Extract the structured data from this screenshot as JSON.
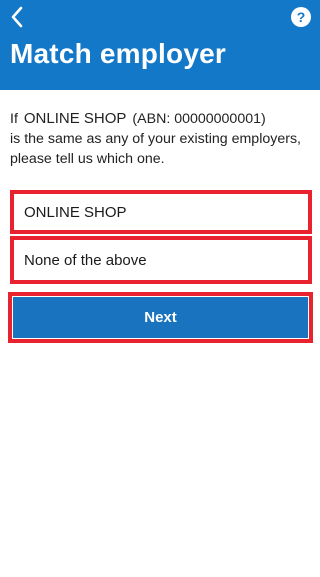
{
  "header": {
    "title": "Match employer",
    "back_icon": "chevron-left-icon",
    "help_icon": "help-circle-icon",
    "background_color": "#1478c8"
  },
  "intro": {
    "prefix": "If",
    "employer_name": "ONLINE SHOP",
    "abn": "(ABN: 00000000001)",
    "line2": "is the same as any of your existing employers,",
    "line3": "please tell us which one."
  },
  "options": [
    {
      "label": "ONLINE SHOP"
    },
    {
      "label": "None of the above"
    }
  ],
  "next_button": {
    "label": "Next",
    "color": "#1a73bf"
  },
  "highlight_color": "#e8222e"
}
